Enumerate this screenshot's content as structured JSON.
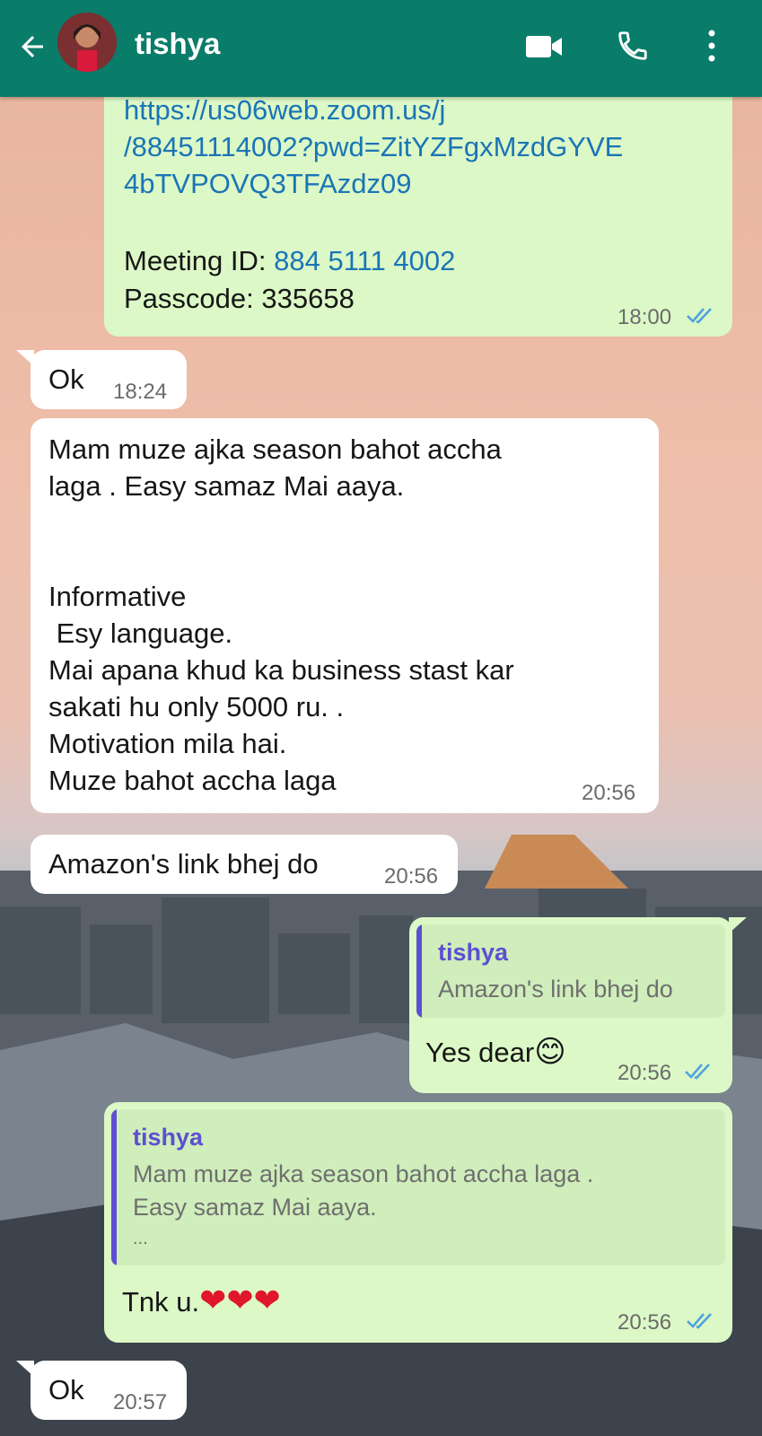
{
  "header": {
    "contact_name": "tishya",
    "icons": [
      "back-arrow-icon",
      "video-call-icon",
      "phone-icon",
      "more-vert-icon"
    ]
  },
  "colors": {
    "header": "#0a7c6a",
    "outgoing": "#dcf8c6",
    "incoming": "#ffffff",
    "link": "#1a75b6",
    "quote_accent": "#5d4fd1",
    "read_ticks": "#4fa3e0"
  },
  "messages": {
    "m1": {
      "link_l1": "https://us06web.zoom.us/j",
      "link_l2": "/88451114002?pwd=ZitYZFgxMzdGYVE",
      "link_l3": "4bTVPOVQ3TFAzdz09",
      "meeting_label": "Meeting ID: ",
      "meeting_id": "884 5111 4002",
      "passcode": "Passcode: 335658",
      "time": "18:00"
    },
    "m2": {
      "text": "Ok",
      "time": "18:24"
    },
    "m3": {
      "l1": "Mam muze ajka season bahot accha",
      "l2": "laga . Easy samaz Mai aaya.",
      "l3": "Informative",
      "l4": " Esy language.",
      "l5": "Mai apana khud ka business stast kar",
      "l6": "sakati hu only 5000 ru. .",
      "l7": "Motivation mila hai.",
      "l8": "Muze bahot accha laga",
      "time": "20:56"
    },
    "m4": {
      "text": "Amazon's link bhej do",
      "time": "20:56"
    },
    "m5": {
      "quote_name": "tishya",
      "quote_text": "Amazon's link bhej do",
      "text": "Yes dear",
      "emoji": "😊",
      "time": "20:56"
    },
    "m6": {
      "quote_name": "tishya",
      "quote_l1": "Mam muze ajka season bahot accha laga .",
      "quote_l2": "Easy samaz Mai aaya.",
      "quote_l3": "...",
      "text": "Tnk u.",
      "hearts": "❤❤❤",
      "time": "20:56"
    },
    "m7": {
      "text": "Ok",
      "time": "20:57"
    }
  }
}
